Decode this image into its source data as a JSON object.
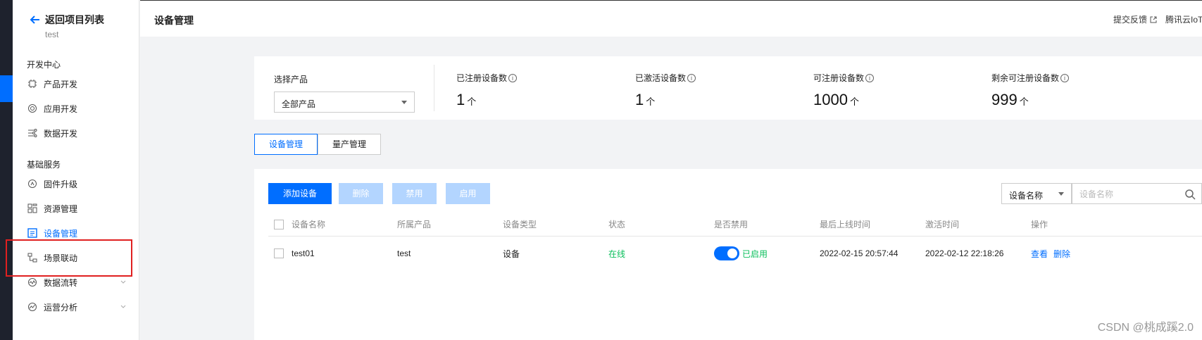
{
  "sidebar": {
    "back_label": "返回项目列表",
    "project_name": "test",
    "groups": [
      {
        "label": "开发中心"
      },
      {
        "label": "基础服务"
      }
    ],
    "items": [
      {
        "label": "产品开发",
        "icon": "chip-icon"
      },
      {
        "label": "应用开发",
        "icon": "app-icon"
      },
      {
        "label": "数据开发",
        "icon": "data-dev-icon"
      },
      {
        "label": "固件升级",
        "icon": "firmware-icon"
      },
      {
        "label": "资源管理",
        "icon": "resource-icon"
      },
      {
        "label": "设备管理",
        "icon": "device-list-icon",
        "active": true
      },
      {
        "label": "场景联动",
        "icon": "scene-icon"
      },
      {
        "label": "数据流转",
        "icon": "flow-icon"
      },
      {
        "label": "运营分析",
        "icon": "analytics-icon"
      }
    ]
  },
  "header": {
    "title": "设备管理",
    "feedback": "提交反馈",
    "brand": "腾讯云IoT"
  },
  "stats": {
    "select_label": "选择产品",
    "select_value": "全部产品",
    "items": [
      {
        "label": "已注册设备数",
        "value": "1",
        "unit": "个"
      },
      {
        "label": "已激活设备数",
        "value": "1",
        "unit": "个"
      },
      {
        "label": "可注册设备数",
        "value": "1000",
        "unit": "个"
      },
      {
        "label": "剩余可注册设备数",
        "value": "999",
        "unit": "个"
      }
    ]
  },
  "tabs": [
    {
      "label": "设备管理",
      "active": true
    },
    {
      "label": "量产管理",
      "active": false
    }
  ],
  "toolbar": {
    "add": "添加设备",
    "delete": "删除",
    "disable": "禁用",
    "enable": "启用",
    "filter_value": "设备名称",
    "search_placeholder": "设备名称"
  },
  "table": {
    "columns": [
      "设备名称",
      "所属产品",
      "设备类型",
      "状态",
      "是否禁用",
      "最后上线时间",
      "激活时间",
      "操作"
    ],
    "rows": [
      {
        "name": "test01",
        "product": "test",
        "type": "设备",
        "status": "在线",
        "enabled_text": "已启用",
        "last_online": "2022-02-15 20:57:44",
        "activated": "2022-02-12 22:18:26",
        "actions": [
          "查看",
          "删除"
        ]
      }
    ]
  },
  "colors": {
    "accent": "#006eff",
    "online": "#0abf5b",
    "highlight": "#e02020"
  },
  "watermark": "CSDN @桃成蹊2.0"
}
